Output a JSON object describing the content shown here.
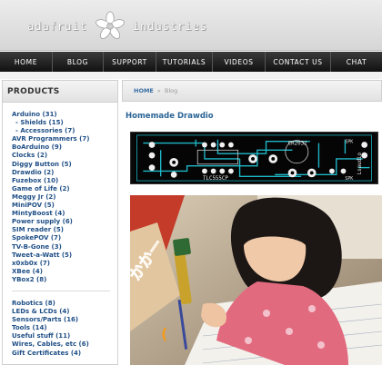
{
  "header": {
    "logo_left": "adafruit",
    "logo_right": "industries"
  },
  "nav": {
    "items": [
      {
        "label": "HOME",
        "name": "nav-home"
      },
      {
        "label": "BLOG",
        "name": "nav-blog"
      },
      {
        "label": "SUPPORT",
        "name": "nav-support"
      },
      {
        "label": "TUTORIALS",
        "name": "nav-tutorials"
      },
      {
        "label": "VIDEOS",
        "name": "nav-videos"
      },
      {
        "label": "CONTACT US",
        "name": "nav-contact-us"
      },
      {
        "label": "CHAT",
        "name": "nav-chat"
      }
    ]
  },
  "sidebar": {
    "title": "PRODUCTS",
    "group1": [
      {
        "label": "Arduino (31)",
        "sub": false
      },
      {
        "label": "- Shields (15)",
        "sub": true
      },
      {
        "label": "- Accessories (7)",
        "sub": true
      },
      {
        "label": "AVR Programmers (7)",
        "sub": false
      },
      {
        "label": "BoArduino (9)",
        "sub": false
      },
      {
        "label": "Clocks (2)",
        "sub": false
      },
      {
        "label": "Diggy Button (5)",
        "sub": false
      },
      {
        "label": "Drawdio (2)",
        "sub": false
      },
      {
        "label": "Fuzebox (10)",
        "sub": false
      },
      {
        "label": "Game of Life (2)",
        "sub": false
      },
      {
        "label": "Meggy Jr (2)",
        "sub": false
      },
      {
        "label": "MiniPOV (5)",
        "sub": false
      },
      {
        "label": "MintyBoost (4)",
        "sub": false
      },
      {
        "label": "Power supply (6)",
        "sub": false
      },
      {
        "label": "SIM reader (5)",
        "sub": false
      },
      {
        "label": "SpokePOV (7)",
        "sub": false
      },
      {
        "label": "TV-B-Gone (3)",
        "sub": false
      },
      {
        "label": "Tweet-a-Watt (5)",
        "sub": false
      },
      {
        "label": "x0xb0x (7)",
        "sub": false
      },
      {
        "label": "XBee (4)",
        "sub": false
      },
      {
        "label": "YBox2 (8)",
        "sub": false
      }
    ],
    "group2": [
      {
        "label": "Robotics (8)"
      },
      {
        "label": "LEDs & LCDs (4)"
      },
      {
        "label": "Sensors/Parts (16)"
      },
      {
        "label": "Tools (14)"
      },
      {
        "label": "Useful stuff (11)"
      },
      {
        "label": "Wires, Cables, etc (6)"
      },
      {
        "label": "Gift Certificates (4)"
      }
    ]
  },
  "main": {
    "breadcrumb_home": "HOME",
    "breadcrumb_sep": "»",
    "breadcrumb_current": "Blog",
    "title": "Homemade Drawdio",
    "pcb_label_1": "TLC555CP",
    "pcb_label_2": "CR2032",
    "pcb_label_3": "SPK",
    "pcb_label_4": "SPK",
    "pcb_label_5": "Lsaudio",
    "photo_caption_text": "かかー"
  },
  "colors": {
    "link": "#1f4f86",
    "title": "#2a6496",
    "nav_bg": "#1a1a1a",
    "pcb_trace": "#1fb8c8"
  }
}
